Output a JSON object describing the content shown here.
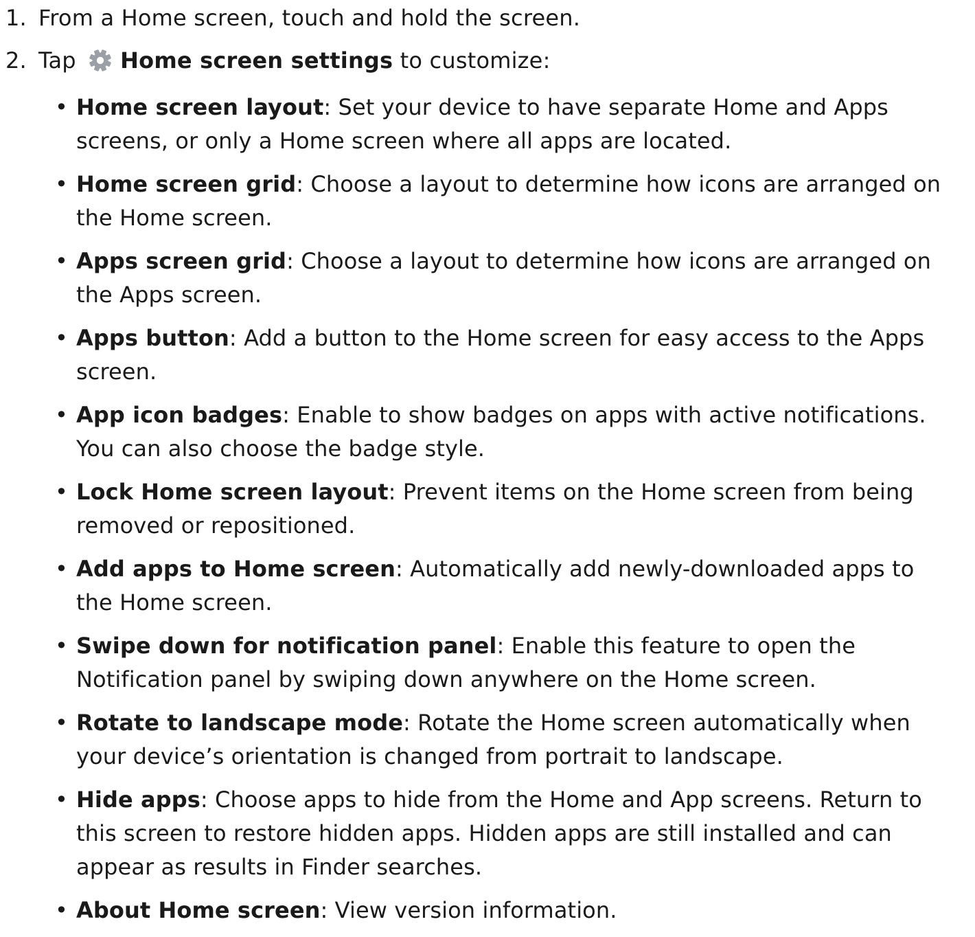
{
  "steps": [
    {
      "number": "1.",
      "text": "From a Home screen, touch and hold the screen."
    },
    {
      "number": "2.",
      "text_before": "Tap",
      "icon": "gear-icon",
      "strong": "Home screen settings",
      "text_after": "to customize:"
    }
  ],
  "icon_color": "#9aa0a6",
  "bullet_symbol": "•",
  "items": [
    {
      "term": "Home screen layout",
      "desc": ": Set your device to have separate Home and Apps screens, or only a Home screen where all apps are located."
    },
    {
      "term": "Home screen grid",
      "desc": ": Choose a layout to determine how icons are arranged on the Home screen."
    },
    {
      "term": "Apps screen grid",
      "desc": ": Choose a layout to determine how icons are arranged on the Apps screen."
    },
    {
      "term": "Apps button",
      "desc": ": Add a button to the Home screen for easy access to the Apps screen."
    },
    {
      "term": "App icon badges",
      "desc": ": Enable to show badges on apps with active notifications. You can also choose the badge style."
    },
    {
      "term": "Lock Home screen layout",
      "desc": ": Prevent items on the Home screen from being removed or repositioned."
    },
    {
      "term": "Add apps to Home screen",
      "desc": ": Automatically add newly-downloaded apps to the Home screen."
    },
    {
      "term": "Swipe down for notification panel",
      "desc": ": Enable this feature to open the Notification panel by swiping down anywhere on the Home screen."
    },
    {
      "term": "Rotate to landscape mode",
      "desc": ": Rotate the Home screen automatically when your device’s orientation is changed from portrait to landscape."
    },
    {
      "term": "Hide apps",
      "desc": ": Choose apps to hide from the Home and App screens. Return to this screen to restore hidden apps. Hidden apps are still installed and can appear as results in Finder searches."
    },
    {
      "term": "About Home screen",
      "desc": ": View version information."
    }
  ]
}
